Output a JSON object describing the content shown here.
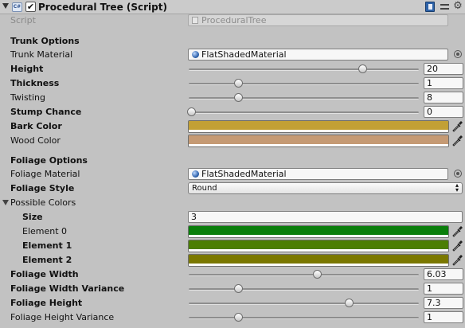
{
  "component": {
    "title": "Procedural Tree (Script)",
    "enabled_mark": "✔",
    "script_label": "Script",
    "script_value": "ProceduralTree"
  },
  "trunk": {
    "section": "Trunk Options",
    "material": {
      "label": "Trunk Material",
      "value": "FlatShadedMaterial"
    },
    "height": {
      "label": "Height",
      "value": "20",
      "fraction": 0.76
    },
    "thickness": {
      "label": "Thickness",
      "value": "1",
      "fraction": 0.21
    },
    "twisting": {
      "label": "Twisting",
      "value": "8",
      "fraction": 0.21
    },
    "stump": {
      "label": "Stump Chance",
      "value": "0",
      "fraction": 0.0
    },
    "bark_color": {
      "label": "Bark Color",
      "color": "#c2a035"
    },
    "wood_color": {
      "label": "Wood Color",
      "color": "#c59a74"
    }
  },
  "foliage": {
    "section": "Foliage Options",
    "material": {
      "label": "Foliage Material",
      "value": "FlatShadedMaterial"
    },
    "style": {
      "label": "Foliage Style",
      "value": "Round"
    },
    "colors": {
      "label": "Possible Colors",
      "size_label": "Size",
      "size_value": "3",
      "elements": [
        {
          "label": "Element 0",
          "color": "#0a7e0b"
        },
        {
          "label": "Element 1",
          "color": "#4b7e04"
        },
        {
          "label": "Element 2",
          "color": "#7b7800"
        }
      ]
    },
    "width": {
      "label": "Foliage Width",
      "value": "6.03",
      "fraction": 0.56
    },
    "width_var": {
      "label": "Foliage Width Variance",
      "value": "1",
      "fraction": 0.21
    },
    "height": {
      "label": "Foliage Height",
      "value": "7.3",
      "fraction": 0.7
    },
    "height_var": {
      "label": "Foliage Height Variance",
      "value": "1",
      "fraction": 0.21
    }
  }
}
